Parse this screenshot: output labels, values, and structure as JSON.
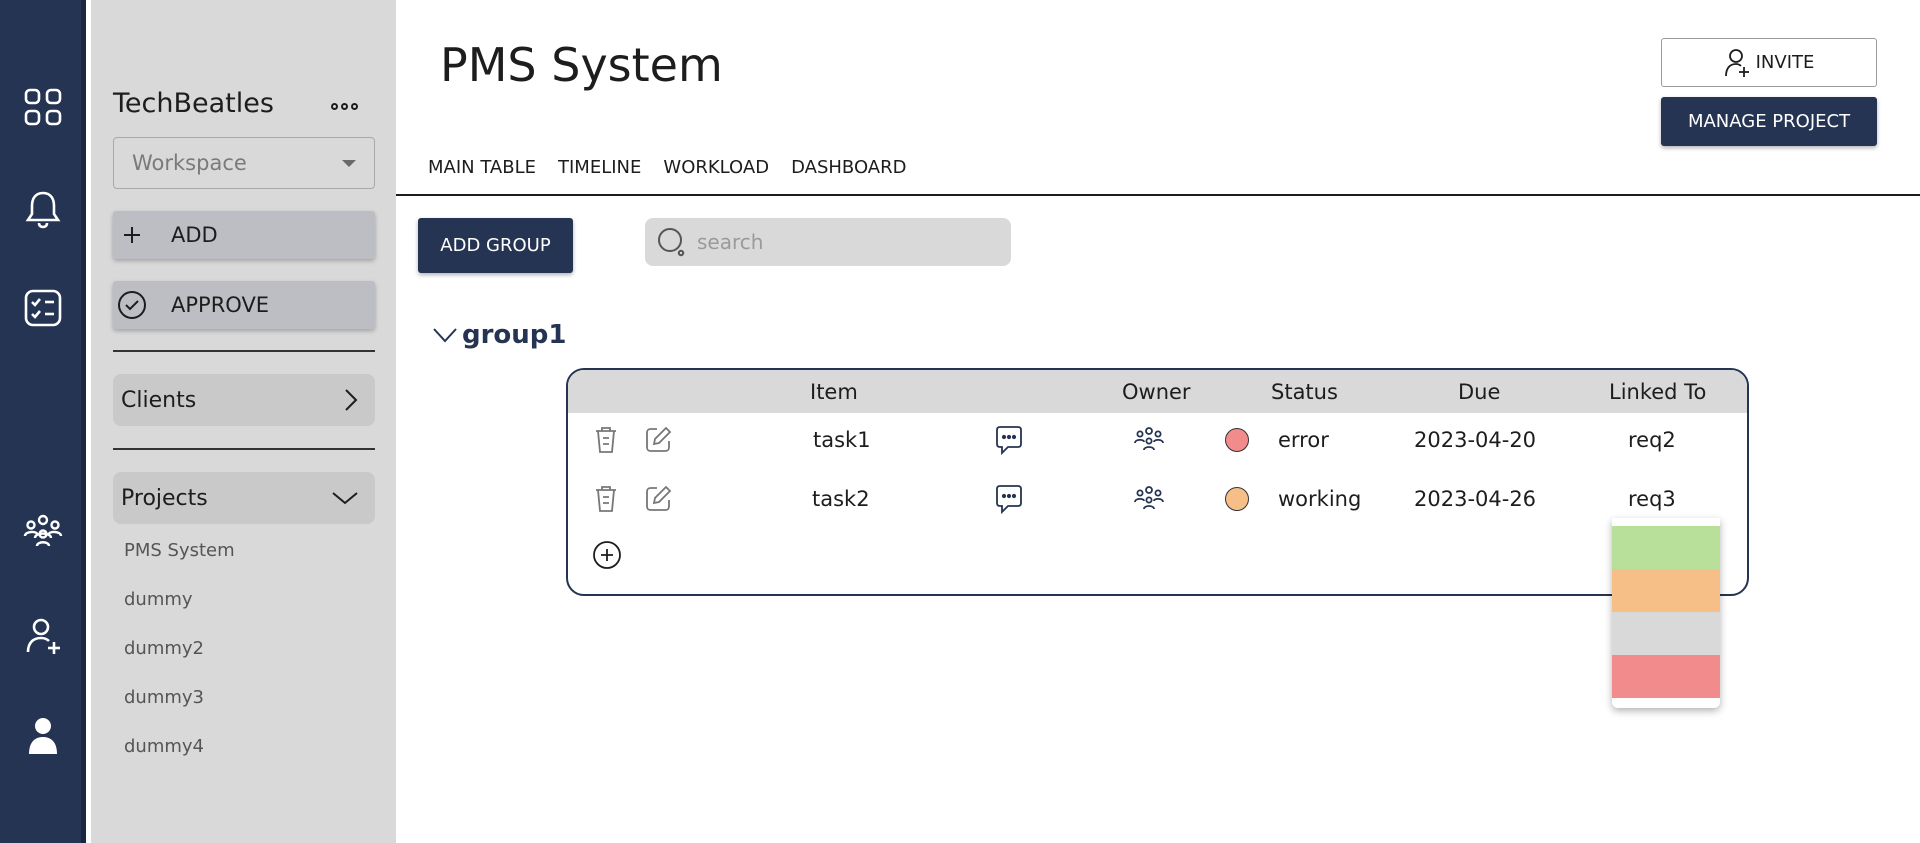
{
  "rail": {
    "items": [
      {
        "name": "dashboard-icon"
      },
      {
        "name": "bell-icon"
      },
      {
        "name": "checklist-icon"
      },
      {
        "name": "team-icon"
      },
      {
        "name": "add-user-icon"
      },
      {
        "name": "profile-icon"
      }
    ],
    "color": "#243452"
  },
  "sidebar": {
    "workspace_title": "TechBeatles",
    "workspace_select": "Workspace",
    "add_label": "ADD",
    "approve_label": "APPROVE",
    "clients_label": "Clients",
    "projects_label": "Projects",
    "projects": [
      "PMS System",
      "dummy",
      "dummy2",
      "dummy3",
      "dummy4"
    ]
  },
  "header": {
    "title": "PMS System",
    "invite_label": "INVITE",
    "manage_label": "MANAGE PROJECT"
  },
  "tabs": [
    "MAIN TABLE",
    "TIMELINE",
    "WORKLOAD",
    "DASHBOARD"
  ],
  "toolbar": {
    "add_group_label": "ADD GROUP",
    "search_placeholder": "search"
  },
  "group": {
    "name": "group1",
    "columns": {
      "item": "Item",
      "owner": "Owner",
      "status": "Status",
      "due": "Due",
      "linked": "Linked To"
    },
    "rows": [
      {
        "item": "task1",
        "status": "error",
        "status_color": "#f28b8b",
        "due": "2023-04-20",
        "linked": "req2"
      },
      {
        "item": "task2",
        "status": "working",
        "status_color": "#f7bf88",
        "due": "2023-04-26",
        "linked": "req3"
      }
    ]
  },
  "status_options": [
    {
      "name": "status-option-done",
      "color": "#b9e09a"
    },
    {
      "name": "status-option-working",
      "color": "#f7bf88"
    },
    {
      "name": "status-option-none",
      "color": "#d9d9d9"
    },
    {
      "name": "status-option-error",
      "color": "#f28b8b"
    }
  ]
}
